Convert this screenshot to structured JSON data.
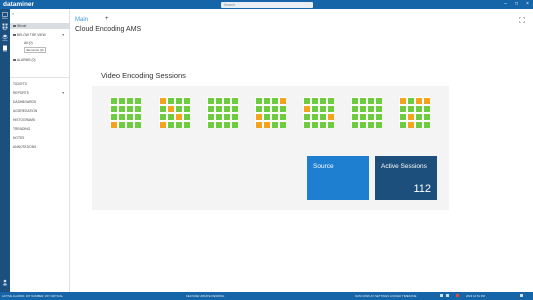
{
  "app": {
    "title": "dataminer",
    "search_placeholder": "Search",
    "window_controls": [
      "minimize-icon",
      "maximize-icon",
      "close-icon"
    ]
  },
  "rail": {
    "items": [
      {
        "icon": "monitoring-icon",
        "label": "Monitor"
      },
      {
        "icon": "grid-icon",
        "label": "Apps"
      },
      {
        "icon": "layers-icon",
        "label": "Layers"
      },
      {
        "icon": "document-icon",
        "label": "Docs"
      },
      {
        "icon": "user-icon",
        "label": "User"
      }
    ]
  },
  "sidebar": {
    "close": "×",
    "items": [
      {
        "label": "Whole",
        "selected": true,
        "type": "checkbox"
      },
      {
        "label": "BELOW THE VIEW",
        "type": "checkbox",
        "caret": "▾"
      },
      {
        "label": "All (0)",
        "type": "sub"
      },
      {
        "label": "Elements (0)",
        "type": "sub-tag"
      },
      {
        "label": "ALARMS (0)",
        "type": "checkbox"
      },
      {
        "label": "TICKETS",
        "type": "section"
      },
      {
        "label": "REPORTS",
        "type": "section",
        "caret": "▾"
      },
      {
        "label": "DASHBOARDS",
        "type": "section"
      },
      {
        "label": "AGGREGATION",
        "type": "section"
      },
      {
        "label": "HISTOGRAMS",
        "type": "section"
      },
      {
        "label": "TRENDING",
        "type": "section"
      },
      {
        "label": "NOTES",
        "type": "section"
      },
      {
        "label": "ANNOTATIONS",
        "type": "section"
      }
    ]
  },
  "main": {
    "breadcrumb": "Main",
    "add_label": "+",
    "page_title": "Cloud Encoding AMS",
    "canvas_title": "Video Encoding Sessions",
    "expand_icon": "expand-icon"
  },
  "colors": {
    "green": "#6dcc3f",
    "orange": "#f4a31d",
    "source_tile": "#1e7fd1",
    "active_tile": "#1d4f7c",
    "brand": "#1565a8"
  },
  "sessions": [
    {
      "cells": [
        "g",
        "g",
        "g",
        "g",
        "g",
        "g",
        "g",
        "g",
        "g",
        "g",
        "g",
        "g",
        "o",
        "g",
        "g",
        "g"
      ]
    },
    {
      "cells": [
        "o",
        "g",
        "g",
        "g",
        "g",
        "o",
        "g",
        "g",
        "g",
        "g",
        "o",
        "g",
        "o",
        "g",
        "g",
        "g"
      ]
    },
    {
      "cells": [
        "g",
        "g",
        "g",
        "g",
        "g",
        "g",
        "g",
        "g",
        "g",
        "g",
        "g",
        "g",
        "g",
        "g",
        "g",
        "g"
      ]
    },
    {
      "cells": [
        "g",
        "g",
        "g",
        "o",
        "g",
        "g",
        "g",
        "g",
        "o",
        "g",
        "g",
        "g",
        "o",
        "o",
        "g",
        "g"
      ]
    },
    {
      "cells": [
        "g",
        "g",
        "g",
        "g",
        "o",
        "g",
        "g",
        "g",
        "g",
        "g",
        "g",
        "o",
        "g",
        "g",
        "g",
        "g"
      ]
    },
    {
      "cells": [
        "g",
        "g",
        "g",
        "g",
        "g",
        "g",
        "g",
        "g",
        "g",
        "g",
        "g",
        "g",
        "g",
        "g",
        "g",
        "g"
      ]
    },
    {
      "cells": [
        "o",
        "g",
        "o",
        "o",
        "g",
        "g",
        "g",
        "g",
        "g",
        "o",
        "g",
        "g",
        "g",
        "o",
        "g",
        "g"
      ]
    }
  ],
  "tiles": {
    "source_label": "Source",
    "active_label": "Active Sessions",
    "active_value": "112"
  },
  "statusbar": {
    "left": "ACTIVE ALARMS: 267 NUMBER: 267 CRITICAL",
    "center": "FEATURE UPDATE PENDING",
    "right": "DATA DISPLAY  SETTINGS  LOCKED  TIMEZONE",
    "clock": "2023 10:51 PM"
  }
}
